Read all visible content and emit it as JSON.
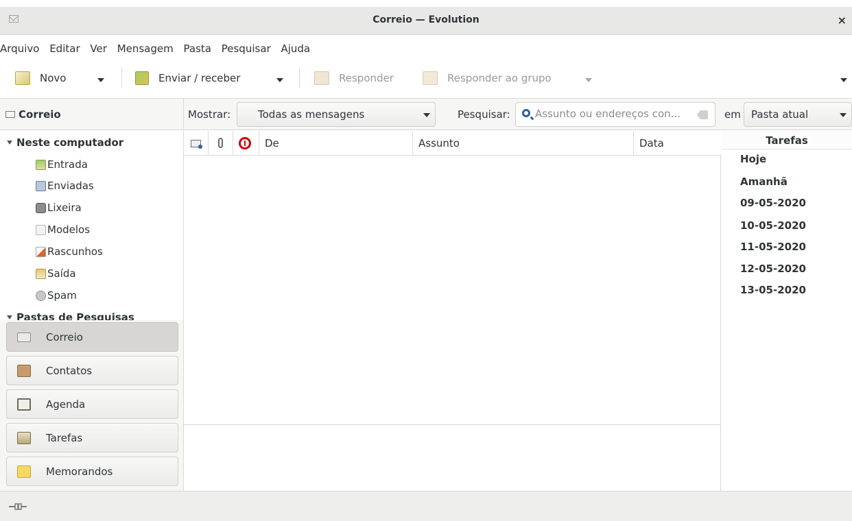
{
  "window": {
    "title": "Correio — Evolution",
    "close_glyph": "×",
    "app_icon": "envelope-icon"
  },
  "menu": [
    "Arquivo",
    "Editar",
    "Ver",
    "Mensagem",
    "Pasta",
    "Pesquisar",
    "Ajuda"
  ],
  "toolbar": {
    "novo": "Novo",
    "enviar_receber": "Enviar / receber",
    "responder": "Responder",
    "responder_grupo": "Responder ao grupo"
  },
  "sidebar": {
    "header": "Correio",
    "tree": {
      "root": "Neste computador",
      "folders": [
        "Entrada",
        "Enviadas",
        "Lixeira",
        "Modelos",
        "Rascunhos",
        "Saída",
        "Spam"
      ],
      "search_folders": "Pastas de Pesquisas"
    },
    "switcher": [
      "Correio",
      "Contatos",
      "Agenda",
      "Tarefas",
      "Memorandos"
    ]
  },
  "filter": {
    "mostrar_label": "Mostrar:",
    "mostrar_value": "Todas as mensagens",
    "pesquisar_label": "Pesquisar:",
    "search_placeholder": "Assunto ou endereços con...",
    "em_label": "em",
    "em_value": "Pasta atual"
  },
  "message_list": {
    "columns": {
      "de": "De",
      "assunto": "Assunto",
      "data": "Data"
    }
  },
  "tasks": {
    "header": "Tarefas",
    "rows": [
      "Hoje",
      "Amanhã",
      "09-05-2020",
      "10-05-2020",
      "11-05-2020",
      "12-05-2020",
      "13-05-2020"
    ]
  },
  "colors": {
    "flag_red": "#cc0000",
    "search_blue": "#2a5ea8",
    "active_switcher": "#d8d6d4"
  }
}
